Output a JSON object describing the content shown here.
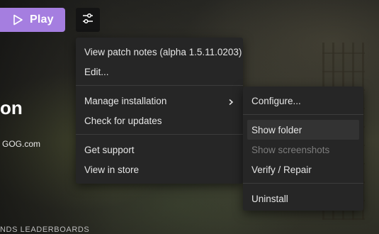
{
  "play_button": {
    "label": "Play",
    "icon": "play-outline-icon",
    "color": "#a57ee0"
  },
  "settings_button": {
    "icon": "sliders-icon"
  },
  "background": {
    "title_fragment": "on",
    "source_fragment": "GOG.com",
    "bottom_fragment": "NDS LEADERBOARDS"
  },
  "main_menu": {
    "groups": [
      [
        "View patch notes (alpha 1.5.11.0203)",
        "Edit..."
      ],
      [
        "Manage installation",
        "Check for updates"
      ],
      [
        "Get support",
        "View in store"
      ]
    ],
    "submenu_chevron_icon": "chevron-right-icon"
  },
  "sub_menu": {
    "items": [
      {
        "label": "Configure...",
        "state": "enabled"
      },
      {
        "label": "Show folder",
        "state": "hovered"
      },
      {
        "label": "Show screenshots",
        "state": "disabled"
      },
      {
        "label": "Verify / Repair",
        "state": "enabled"
      },
      {
        "label": "Uninstall",
        "state": "enabled"
      }
    ]
  },
  "colors": {
    "menu_bg": "#262626",
    "menu_text": "#e6e6e6",
    "disabled_text": "#7c7c7c",
    "hover_bg": "#333333"
  }
}
